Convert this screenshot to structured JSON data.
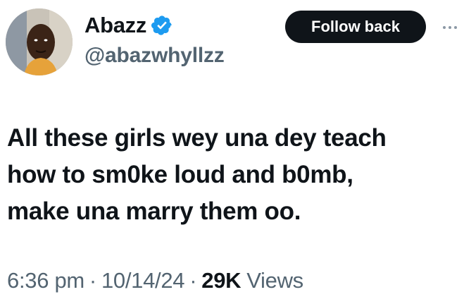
{
  "author": {
    "display_name": "Abazz",
    "handle": "@abazwhyllzz",
    "verified_icon": "verified-badge-icon",
    "verified_color": "#1d9bf0"
  },
  "actions": {
    "follow_label": "Follow back",
    "more_icon": "more-options-icon"
  },
  "tweet": {
    "text": "All these girls wey una dey teach\nhow to sm0ke loud and b0mb,\nmake una marry them oo."
  },
  "meta": {
    "time": "6:36 pm",
    "separator": "·",
    "date": "10/14/24",
    "views_count": "29K",
    "views_label": "Views"
  }
}
